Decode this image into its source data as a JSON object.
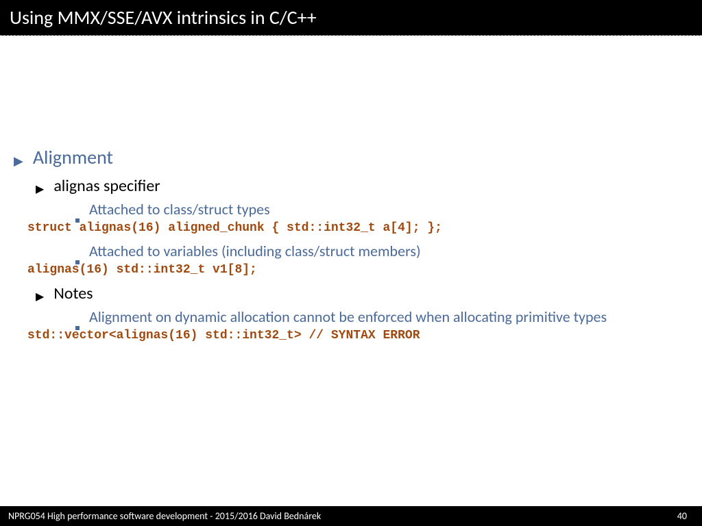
{
  "header": {
    "title": "Using MMX/SSE/AVX intrinsics in C/C++"
  },
  "content": {
    "h1": "Alignment",
    "h2a": "alignas specifier",
    "h3a": "Attached to class/struct types",
    "code1": "struct alignas(16) aligned_chunk { std::int32_t a[4]; };",
    "h3b": "Attached to variables (including class/struct members)",
    "code2": "alignas(16) std::int32_t v1[8];",
    "h2b": "Notes",
    "h3c": "Alignment on dynamic allocation cannot be enforced when allocating primitive types",
    "code3": "std::vector<alignas(16) std::int32_t> // SYNTAX ERROR"
  },
  "footer": {
    "course": "NPRG054 High performance  software development - 2015/2016 David Bednárek",
    "page": "40"
  }
}
